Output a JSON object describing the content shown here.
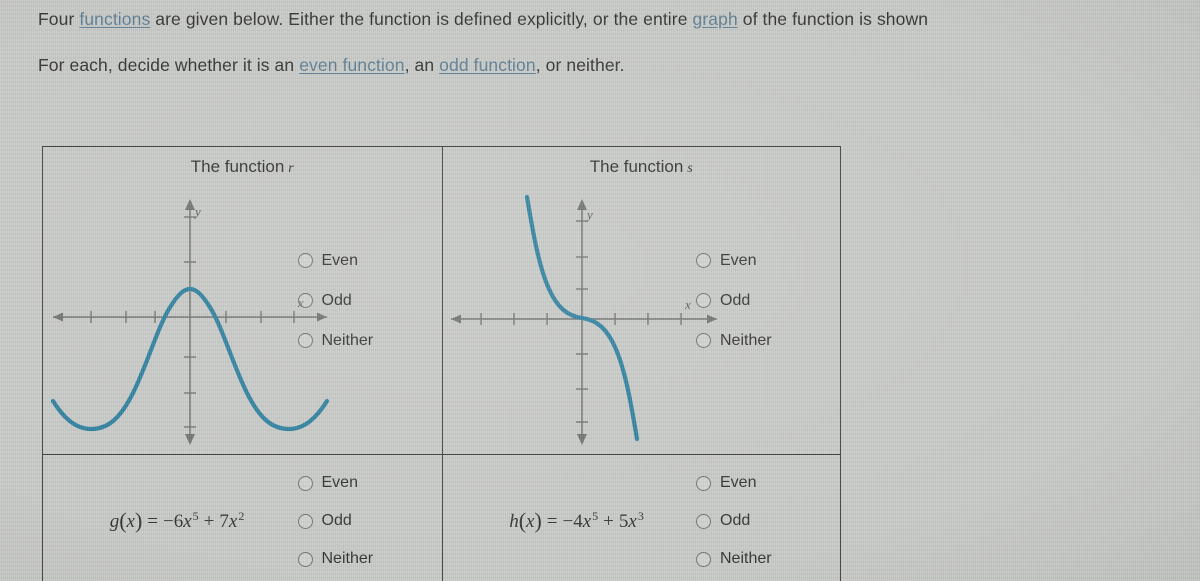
{
  "prompt": {
    "line1_a": "Four ",
    "line1_link1": "functions",
    "line1_b": " are given below. Either the function is defined explicitly, or the entire ",
    "line1_link2": "graph",
    "line1_c": " of the function is shown",
    "line2_a": "For each, decide whether it is an ",
    "line2_link1": "even function",
    "line2_b": ", an ",
    "line2_link2": "odd function",
    "line2_c": ", or neither."
  },
  "colors": {
    "curve": "#2b7f9e",
    "axis": "#6f716e",
    "border": "#3a3a3a",
    "link": "#5b7c92",
    "background": "#c8cac7"
  },
  "cells": [
    {
      "id": "r",
      "title_text": "The function",
      "title_fn": "r",
      "graph_type": "even-cosine-wave",
      "axis_x_label": "x",
      "axis_y_label": "y",
      "options": [
        {
          "label": "Even",
          "selected": false
        },
        {
          "label": "Odd",
          "selected": false
        },
        {
          "label": "Neither",
          "selected": false
        }
      ]
    },
    {
      "id": "s",
      "title_text": "The function",
      "title_fn": "s",
      "graph_type": "odd-decreasing-quintic",
      "axis_x_label": "x",
      "axis_y_label": "y",
      "options": [
        {
          "label": "Even",
          "selected": false
        },
        {
          "label": "Odd",
          "selected": false
        },
        {
          "label": "Neither",
          "selected": false
        }
      ]
    },
    {
      "id": "g",
      "formula": {
        "fn": "g",
        "var": "x",
        "eq": "=",
        "term1_coef": "−6",
        "term1_var": "x",
        "term1_exp": "5",
        "op": "+",
        "term2_coef": "7",
        "term2_var": "x",
        "term2_exp": "2"
      },
      "options": [
        {
          "label": "Even",
          "selected": false
        },
        {
          "label": "Odd",
          "selected": false
        },
        {
          "label": "Neither",
          "selected": false
        }
      ]
    },
    {
      "id": "h",
      "formula": {
        "fn": "h",
        "var": "x",
        "eq": "=",
        "term1_coef": "−4",
        "term1_var": "x",
        "term1_exp": "5",
        "op": "+",
        "term2_coef": "5",
        "term2_var": "x",
        "term2_exp": "3"
      },
      "options": [
        {
          "label": "Even",
          "selected": false
        },
        {
          "label": "Odd",
          "selected": false
        },
        {
          "label": "Neither",
          "selected": false
        }
      ]
    }
  ],
  "chart_data": [
    {
      "type": "line",
      "id": "r",
      "title": "The function r",
      "xlabel": "x",
      "ylabel": "y",
      "xlim": [
        -5.2,
        5.2
      ],
      "ylim": [
        -4.2,
        3.2
      ],
      "grid": false,
      "symmetry": "even",
      "description": "Cosine-like wave, maximum at x=0 with y=1, minima near x=-3.4 and x=3.4 with y=-3",
      "x": [
        -5.0,
        -4.5,
        -4.0,
        -3.5,
        -3.0,
        -2.5,
        -2.0,
        -1.5,
        -1.0,
        -0.5,
        0.0,
        0.5,
        1.0,
        1.5,
        2.0,
        2.5,
        3.0,
        3.5,
        4.0,
        4.5,
        5.0
      ],
      "y": [
        -2.0,
        -2.8,
        -3.0,
        -3.0,
        -2.7,
        -1.8,
        -0.6,
        0.4,
        0.9,
        1.0,
        1.0,
        1.0,
        0.9,
        0.4,
        -0.6,
        -1.8,
        -2.7,
        -3.0,
        -3.0,
        -2.8,
        -2.0
      ]
    },
    {
      "type": "line",
      "id": "s",
      "title": "The function s",
      "xlabel": "x",
      "ylabel": "y",
      "xlim": [
        -5.2,
        5.2
      ],
      "ylim": [
        -4.6,
        3.2
      ],
      "grid": false,
      "symmetry": "odd",
      "description": "Decreasing odd function with flat inflection at the origin, like y = -x^5",
      "x": [
        -1.35,
        -1.2,
        -1.05,
        -0.9,
        -0.75,
        -0.6,
        -0.45,
        -0.3,
        -0.15,
        0.0,
        0.15,
        0.3,
        0.45,
        0.6,
        0.75,
        0.9,
        1.05,
        1.2,
        1.35
      ],
      "y": [
        4.5,
        2.5,
        1.28,
        0.59,
        0.24,
        0.078,
        0.018,
        0.0024,
        0.0001,
        0.0,
        -0.0001,
        -0.0024,
        -0.018,
        -0.078,
        -0.24,
        -0.59,
        -1.28,
        -2.5,
        -4.5
      ]
    }
  ]
}
